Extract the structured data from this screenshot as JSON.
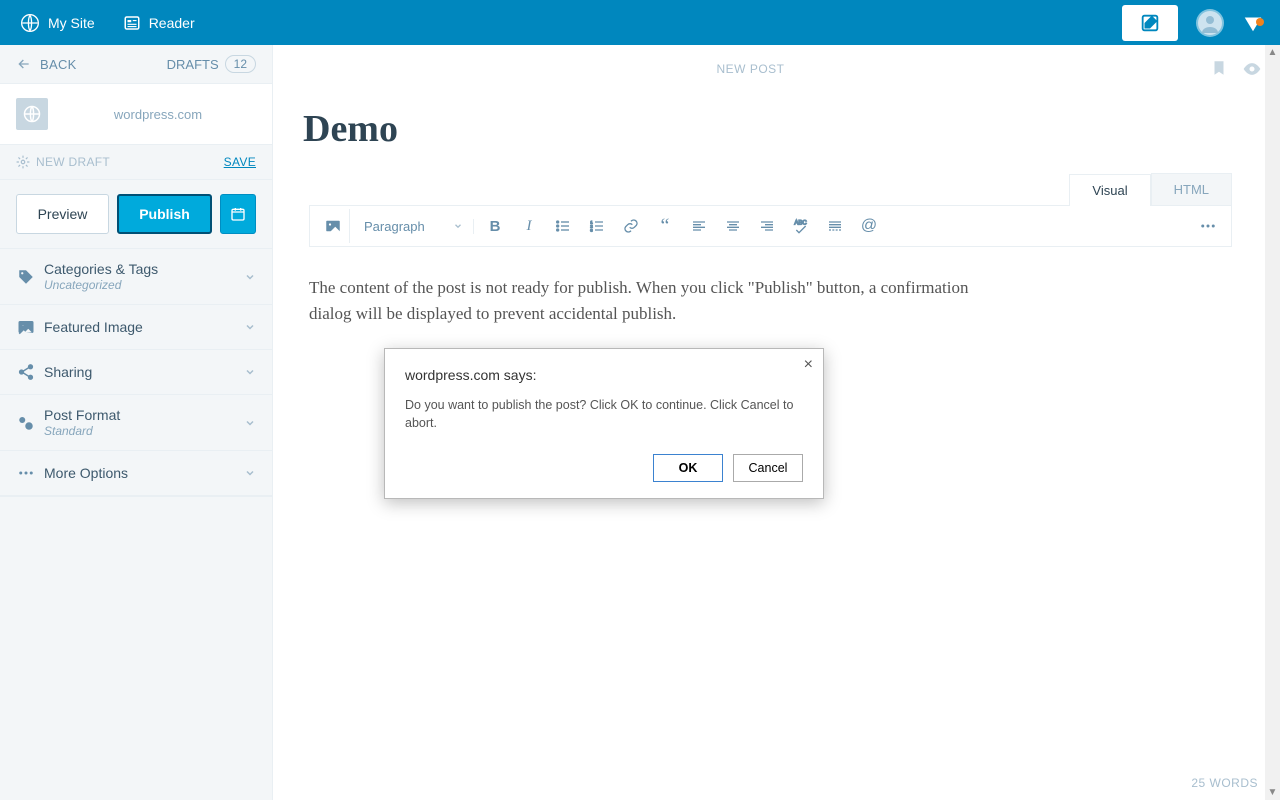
{
  "topbar": {
    "mysite": "My Site",
    "reader": "Reader"
  },
  "sidebar": {
    "back": "BACK",
    "drafts_label": "DRAFTS",
    "drafts_count": "12",
    "site_name": "wordpress.com",
    "new_draft": "NEW DRAFT",
    "save": "SAVE",
    "preview": "Preview",
    "publish": "Publish",
    "accordion": {
      "categories": {
        "label": "Categories & Tags",
        "sub": "Uncategorized"
      },
      "featured": {
        "label": "Featured Image"
      },
      "sharing": {
        "label": "Sharing"
      },
      "format": {
        "label": "Post Format",
        "sub": "Standard"
      },
      "more": {
        "label": "More Options"
      }
    }
  },
  "editor": {
    "header_center": "NEW POST",
    "title": "Demo",
    "tabs": {
      "visual": "Visual",
      "html": "HTML"
    },
    "paragraph": "Paragraph",
    "content": "The content of the post is not ready for publish. When you click \"Publish\" button, a confirmation dialog will be displayed to prevent accidental publish.",
    "wordcount": "25 WORDS"
  },
  "dialog": {
    "title": "wordpress.com says:",
    "message": "Do you want to publish the post? Click OK to continue. Click Cancel to abort.",
    "ok": "OK",
    "cancel": "Cancel"
  }
}
